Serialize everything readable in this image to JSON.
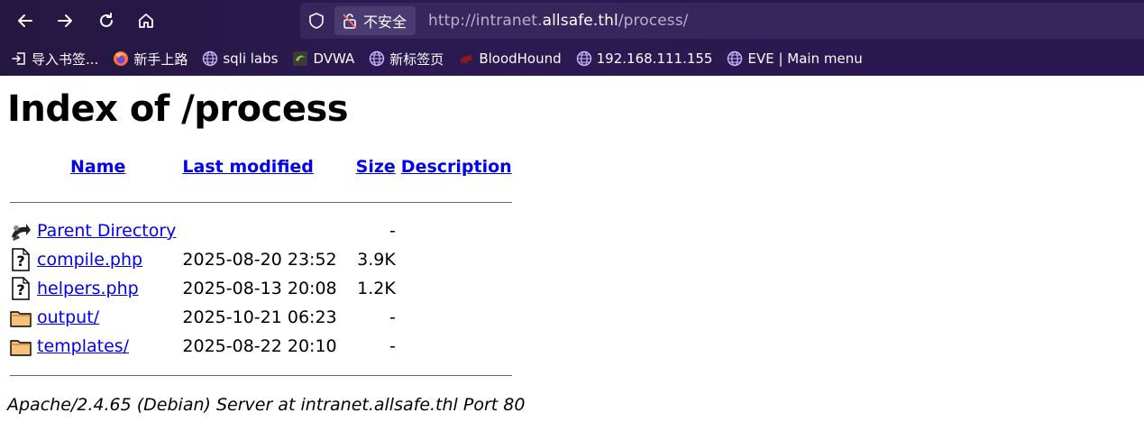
{
  "browser": {
    "url_prefix": "http://intranet.",
    "url_host": "allsafe.thl",
    "url_path": "/process/",
    "security_label": "不安全"
  },
  "bookmarks": [
    {
      "label": "导入书签...",
      "icon": "import-icon"
    },
    {
      "label": "新手上路",
      "icon": "firefox-icon"
    },
    {
      "label": "sqli labs",
      "icon": "globe-icon"
    },
    {
      "label": "DVWA",
      "icon": "dvwa-icon"
    },
    {
      "label": "新标签页",
      "icon": "globe-icon"
    },
    {
      "label": "BloodHound",
      "icon": "bloodhound-icon"
    },
    {
      "label": "192.168.111.155",
      "icon": "globe-icon"
    },
    {
      "label": "EVE | Main menu",
      "icon": "globe-icon"
    }
  ],
  "page": {
    "title": "Index of /process",
    "headers": {
      "name": "Name",
      "last_modified": "Last modified",
      "size": "Size",
      "description": "Description"
    },
    "rows": [
      {
        "icon": "back-icon",
        "name": "Parent Directory",
        "modified": "",
        "size": "-"
      },
      {
        "icon": "unknown-file-icon",
        "name": "compile.php",
        "modified": "2025-08-20 23:52",
        "size": "3.9K"
      },
      {
        "icon": "unknown-file-icon",
        "name": "helpers.php",
        "modified": "2025-08-13 20:08",
        "size": "1.2K"
      },
      {
        "icon": "folder-icon",
        "name": "output/",
        "modified": "2025-10-21 06:23",
        "size": "-"
      },
      {
        "icon": "folder-icon",
        "name": "templates/",
        "modified": "2025-08-22 20:10",
        "size": "-"
      }
    ],
    "footer": "Apache/2.4.65 (Debian) Server at intranet.allsafe.thl Port 80"
  }
}
